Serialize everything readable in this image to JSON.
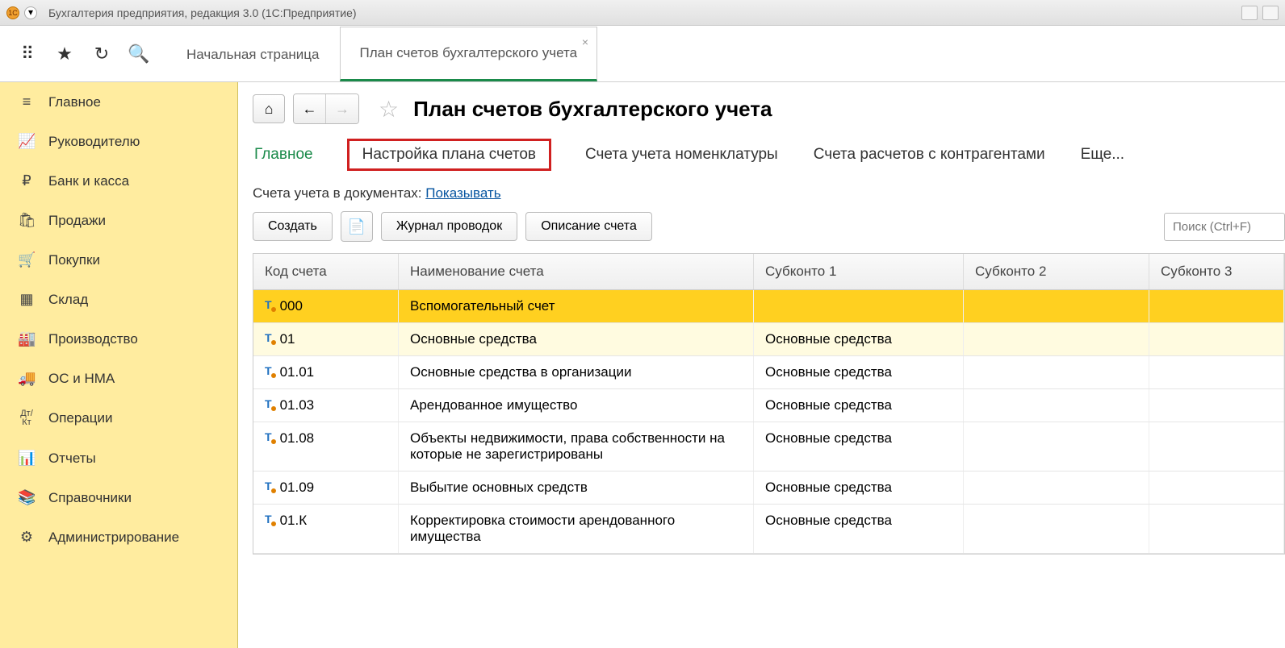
{
  "titlebar": {
    "text": "Бухгалтерия предприятия, редакция 3.0  (1С:Предприятие)"
  },
  "tabs": [
    {
      "label": "Начальная страница",
      "active": false
    },
    {
      "label": "План счетов бухгалтерского учета",
      "active": true
    }
  ],
  "sidebar": [
    {
      "icon": "≡",
      "label": "Главное"
    },
    {
      "icon": "📈",
      "label": "Руководителю"
    },
    {
      "icon": "₽",
      "label": "Банк и касса"
    },
    {
      "icon": "🛍",
      "label": "Продажи"
    },
    {
      "icon": "🛒",
      "label": "Покупки"
    },
    {
      "icon": "▦",
      "label": "Склад"
    },
    {
      "icon": "🏭",
      "label": "Производство"
    },
    {
      "icon": "🚚",
      "label": "ОС и НМА"
    },
    {
      "icon": "Дт/Кт",
      "label": "Операции"
    },
    {
      "icon": "📊",
      "label": "Отчеты"
    },
    {
      "icon": "📚",
      "label": "Справочники"
    },
    {
      "icon": "⚙",
      "label": "Администрирование"
    }
  ],
  "page": {
    "title": "План счетов бухгалтерского учета",
    "subnav": {
      "main": "Главное",
      "settings": "Настройка плана счетов",
      "nomen": "Счета учета номенклатуры",
      "contr": "Счета расчетов с контрагентами",
      "more": "Еще..."
    },
    "docs_label": "Счета учета в документах: ",
    "docs_link": "Показывать",
    "actions": {
      "create": "Создать",
      "journal": "Журнал проводок",
      "descr": "Описание счета"
    },
    "search_placeholder": "Поиск (Ctrl+F)",
    "columns": {
      "code": "Код счета",
      "name": "Наименование счета",
      "s1": "Субконто 1",
      "s2": "Субконто 2",
      "s3": "Субконто 3"
    },
    "rows": [
      {
        "code": "000",
        "name": "Вспомогательный счет",
        "s1": "",
        "sel": true
      },
      {
        "code": "01",
        "name": "Основные средства",
        "s1": "Основные средства",
        "alt": true
      },
      {
        "code": "01.01",
        "name": "Основные средства в организации",
        "s1": "Основные средства"
      },
      {
        "code": "01.03",
        "name": "Арендованное имущество",
        "s1": "Основные средства"
      },
      {
        "code": "01.08",
        "name": "Объекты недвижимости, права собственности на которые не зарегистрированы",
        "s1": "Основные средства"
      },
      {
        "code": "01.09",
        "name": "Выбытие основных средств",
        "s1": "Основные средства"
      },
      {
        "code": "01.К",
        "name": "Корректировка стоимости арендованного имущества",
        "s1": "Основные средства"
      }
    ]
  }
}
